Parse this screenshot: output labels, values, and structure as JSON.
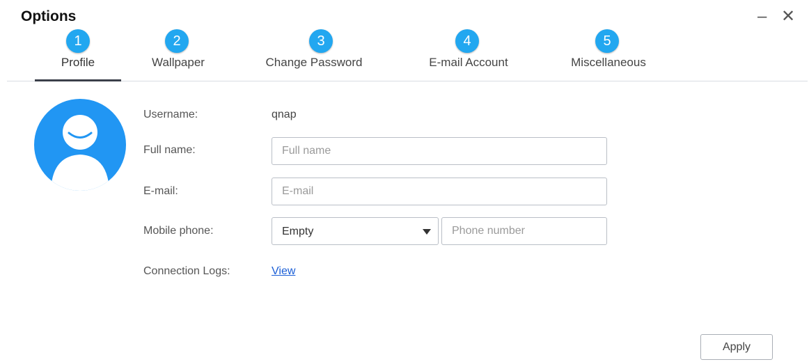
{
  "window": {
    "title": "Options",
    "minimize_icon": "minimize-icon",
    "close_icon": "close-icon"
  },
  "tabs": [
    {
      "number": "1",
      "label": "Profile",
      "active": true
    },
    {
      "number": "2",
      "label": "Wallpaper",
      "active": false
    },
    {
      "number": "3",
      "label": "Change Password",
      "active": false
    },
    {
      "number": "4",
      "label": "E-mail Account",
      "active": false
    },
    {
      "number": "5",
      "label": "Miscellaneous",
      "active": false
    }
  ],
  "profile": {
    "avatar_icon": "user-avatar-icon",
    "username_label": "Username:",
    "username_value": "qnap",
    "fullname_label": "Full name:",
    "fullname_placeholder": "Full name",
    "email_label": "E-mail:",
    "email_placeholder": "E-mail",
    "mobile_label": "Mobile phone:",
    "mobile_country_selected": "Empty",
    "phone_placeholder": "Phone number",
    "connection_logs_label": "Connection Logs:",
    "connection_logs_link": "View"
  },
  "actions": {
    "apply_label": "Apply"
  },
  "colors": {
    "badge": "#22a7f0",
    "active_tab_underline": "#3b3f4a",
    "link": "#1a5ed6",
    "avatar": "#2196f3"
  }
}
